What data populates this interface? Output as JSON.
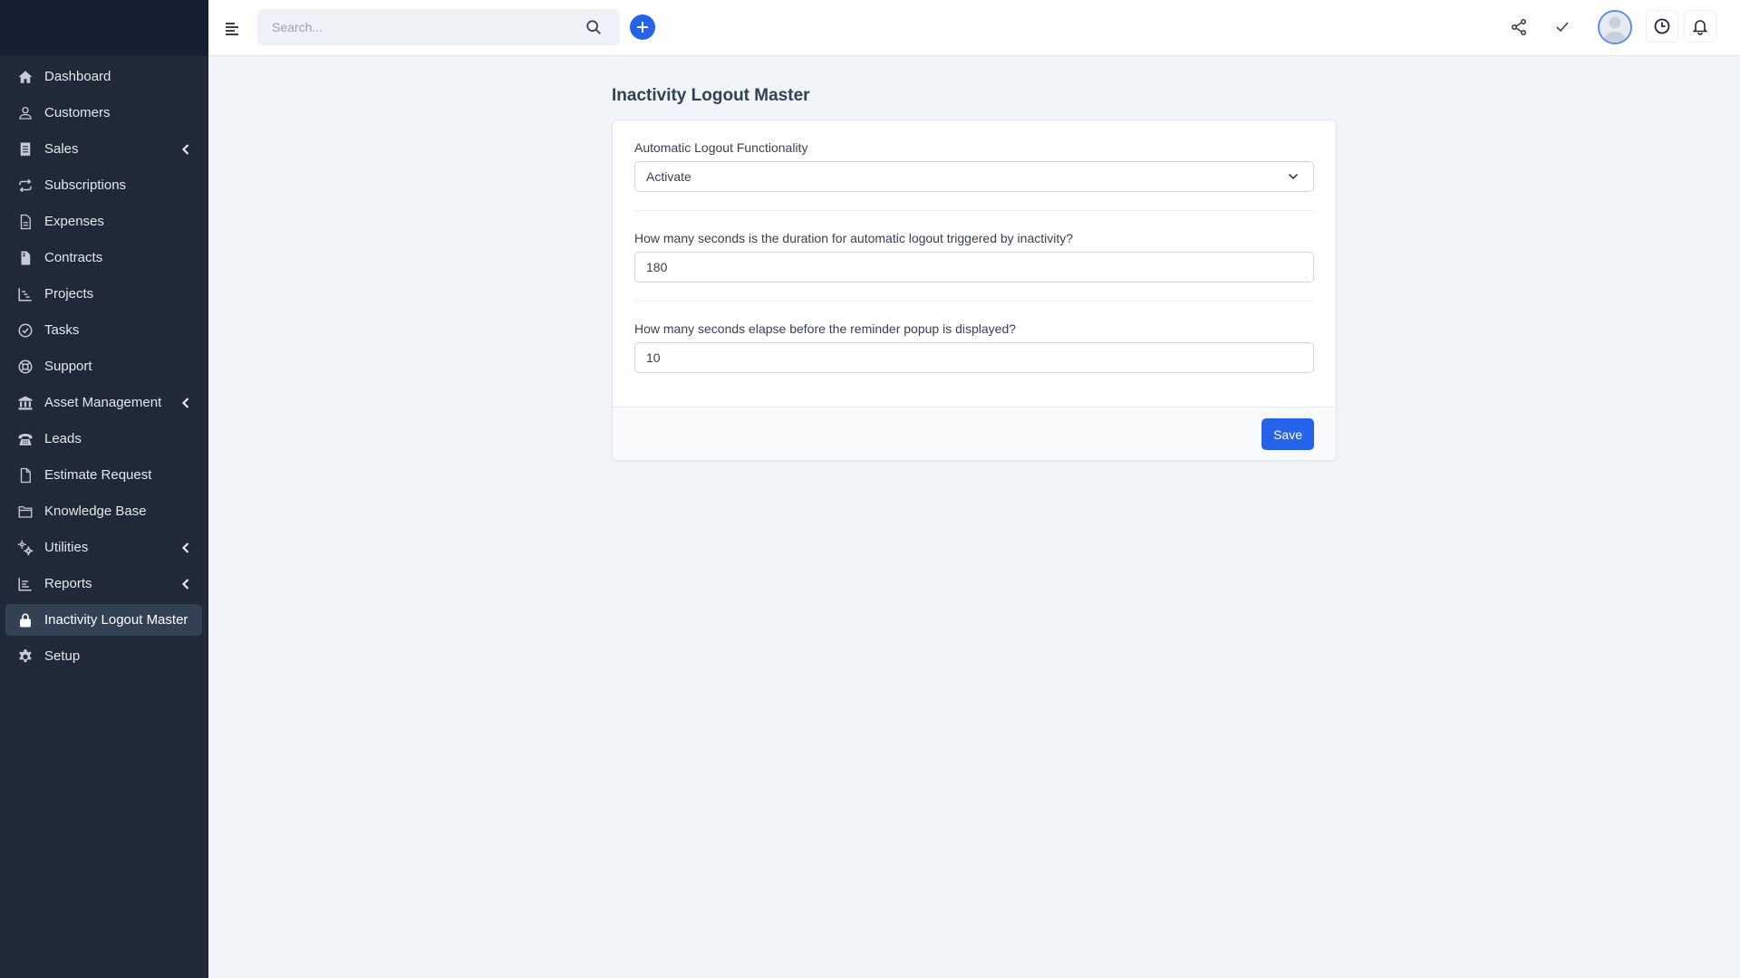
{
  "sidebar": {
    "items": [
      {
        "label": "Dashboard",
        "icon": "home-icon",
        "has_submenu": false,
        "active": false
      },
      {
        "label": "Customers",
        "icon": "user-icon",
        "has_submenu": false,
        "active": false
      },
      {
        "label": "Sales",
        "icon": "receipt-icon",
        "has_submenu": true,
        "active": false
      },
      {
        "label": "Subscriptions",
        "icon": "repeat-icon",
        "has_submenu": false,
        "active": false
      },
      {
        "label": "Expenses",
        "icon": "file-text-icon",
        "has_submenu": false,
        "active": false
      },
      {
        "label": "Contracts",
        "icon": "file-contract-icon",
        "has_submenu": false,
        "active": false
      },
      {
        "label": "Projects",
        "icon": "gantt-chart-icon",
        "has_submenu": false,
        "active": false
      },
      {
        "label": "Tasks",
        "icon": "check-circle-icon",
        "has_submenu": false,
        "active": false
      },
      {
        "label": "Support",
        "icon": "lifebuoy-icon",
        "has_submenu": false,
        "active": false
      },
      {
        "label": "Asset Management",
        "icon": "bank-icon",
        "has_submenu": true,
        "active": false
      },
      {
        "label": "Leads",
        "icon": "phone-icon",
        "has_submenu": false,
        "active": false
      },
      {
        "label": "Estimate Request",
        "icon": "document-icon",
        "has_submenu": false,
        "active": false
      },
      {
        "label": "Knowledge Base",
        "icon": "folder-icon",
        "has_submenu": false,
        "active": false
      },
      {
        "label": "Utilities",
        "icon": "cogs-icon",
        "has_submenu": true,
        "active": false
      },
      {
        "label": "Reports",
        "icon": "bar-chart-icon",
        "has_submenu": true,
        "active": false
      },
      {
        "label": "Inactivity Logout Master",
        "icon": "lock-icon",
        "has_submenu": false,
        "active": true
      },
      {
        "label": "Setup",
        "icon": "gear-icon",
        "has_submenu": false,
        "active": false
      }
    ]
  },
  "header": {
    "search": {
      "placeholder": "Search...",
      "value": ""
    },
    "icons": [
      "menu-icon",
      "search-icon",
      "plus-icon",
      "share-icon",
      "check-icon",
      "avatar",
      "clock-icon",
      "bell-icon"
    ]
  },
  "main": {
    "title": "Inactivity Logout Master",
    "form": {
      "functionality": {
        "label": "Automatic Logout Functionality",
        "selected": "Activate"
      },
      "logout_duration": {
        "label": "How many seconds is the duration for automatic logout triggered by inactivity?",
        "value": "180"
      },
      "reminder_delay": {
        "label": "How many seconds elapse before the reminder popup is displayed?",
        "value": "10"
      },
      "save_label": "Save"
    }
  },
  "colors": {
    "accent": "#2563eb",
    "sidebar_bg": "#1f2937",
    "sidebar_top_bg": "#172032",
    "sidebar_active_bg": "#334155",
    "page_bg": "#f1f4f9"
  }
}
